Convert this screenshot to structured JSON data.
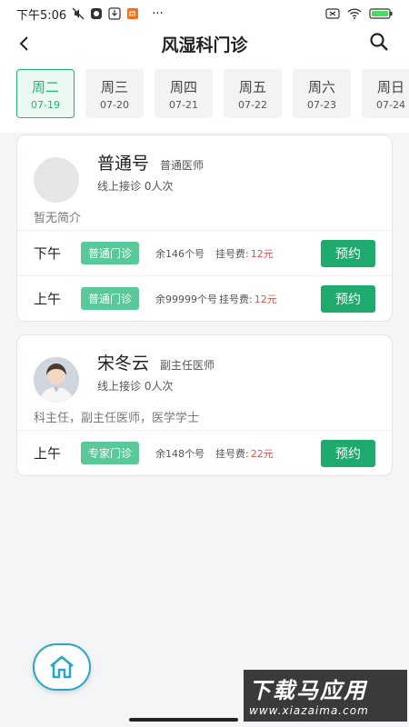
{
  "status_bar": {
    "time": "下午5:06",
    "notif_dots": "···"
  },
  "header": {
    "title": "风湿科门诊"
  },
  "dates": [
    {
      "weekday": "周二",
      "date": "07-19",
      "active": true
    },
    {
      "weekday": "周三",
      "date": "07-20"
    },
    {
      "weekday": "周四",
      "date": "07-21"
    },
    {
      "weekday": "周五",
      "date": "07-22"
    },
    {
      "weekday": "周六",
      "date": "07-23"
    },
    {
      "weekday": "周日",
      "date": "07-24"
    }
  ],
  "doctors": [
    {
      "name": "普通号",
      "title": "普通医师",
      "sub": "线上接诊 0人次",
      "intro": "暂无简介",
      "slots": [
        {
          "period": "下午",
          "type": "普通门诊",
          "remain": "余146个号",
          "fee_label": "挂号费:",
          "fee": "12元",
          "book": "预约"
        },
        {
          "period": "上午",
          "type": "普通门诊",
          "remain": "余99999个号",
          "fee_label": "挂号费:",
          "fee": "12元",
          "book": "预约"
        }
      ]
    },
    {
      "name": "宋冬云",
      "title": "副主任医师",
      "sub": "线上接诊 0人次",
      "intro": "科主任，副主任医师，医学学士",
      "slots": [
        {
          "period": "上午",
          "type": "专家门诊",
          "remain": "余148个号",
          "fee_label": "挂号费:",
          "fee": "22元",
          "book": "预约"
        }
      ]
    }
  ],
  "watermark": {
    "big": "下载马应用",
    "small": "www.xiazaima.com"
  },
  "colors": {
    "accent": "#22b573",
    "badge": "#59c99a",
    "fee": "#e0524c",
    "fab_border": "#28a6c4"
  }
}
